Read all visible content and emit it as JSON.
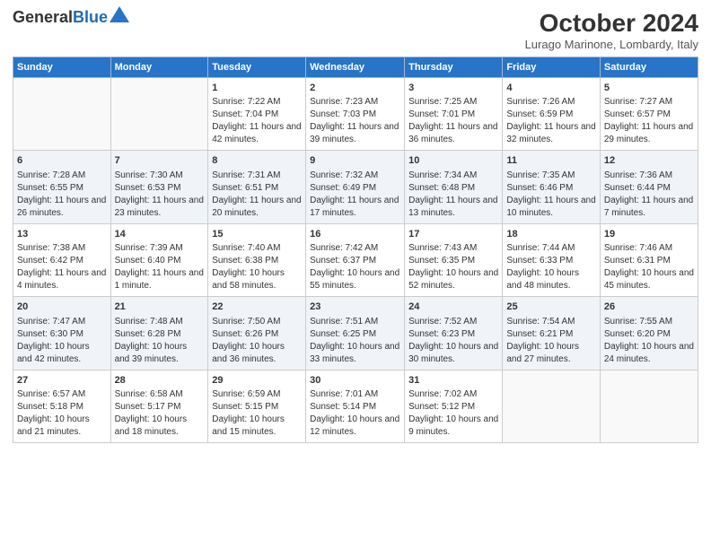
{
  "header": {
    "logo_general": "General",
    "logo_blue": "Blue",
    "month": "October 2024",
    "location": "Lurago Marinone, Lombardy, Italy"
  },
  "days_of_week": [
    "Sunday",
    "Monday",
    "Tuesday",
    "Wednesday",
    "Thursday",
    "Friday",
    "Saturday"
  ],
  "weeks": [
    [
      {
        "day": "",
        "data": ""
      },
      {
        "day": "",
        "data": ""
      },
      {
        "day": "1",
        "data": "Sunrise: 7:22 AM\nSunset: 7:04 PM\nDaylight: 11 hours and 42 minutes."
      },
      {
        "day": "2",
        "data": "Sunrise: 7:23 AM\nSunset: 7:03 PM\nDaylight: 11 hours and 39 minutes."
      },
      {
        "day": "3",
        "data": "Sunrise: 7:25 AM\nSunset: 7:01 PM\nDaylight: 11 hours and 36 minutes."
      },
      {
        "day": "4",
        "data": "Sunrise: 7:26 AM\nSunset: 6:59 PM\nDaylight: 11 hours and 32 minutes."
      },
      {
        "day": "5",
        "data": "Sunrise: 7:27 AM\nSunset: 6:57 PM\nDaylight: 11 hours and 29 minutes."
      }
    ],
    [
      {
        "day": "6",
        "data": "Sunrise: 7:28 AM\nSunset: 6:55 PM\nDaylight: 11 hours and 26 minutes."
      },
      {
        "day": "7",
        "data": "Sunrise: 7:30 AM\nSunset: 6:53 PM\nDaylight: 11 hours and 23 minutes."
      },
      {
        "day": "8",
        "data": "Sunrise: 7:31 AM\nSunset: 6:51 PM\nDaylight: 11 hours and 20 minutes."
      },
      {
        "day": "9",
        "data": "Sunrise: 7:32 AM\nSunset: 6:49 PM\nDaylight: 11 hours and 17 minutes."
      },
      {
        "day": "10",
        "data": "Sunrise: 7:34 AM\nSunset: 6:48 PM\nDaylight: 11 hours and 13 minutes."
      },
      {
        "day": "11",
        "data": "Sunrise: 7:35 AM\nSunset: 6:46 PM\nDaylight: 11 hours and 10 minutes."
      },
      {
        "day": "12",
        "data": "Sunrise: 7:36 AM\nSunset: 6:44 PM\nDaylight: 11 hours and 7 minutes."
      }
    ],
    [
      {
        "day": "13",
        "data": "Sunrise: 7:38 AM\nSunset: 6:42 PM\nDaylight: 11 hours and 4 minutes."
      },
      {
        "day": "14",
        "data": "Sunrise: 7:39 AM\nSunset: 6:40 PM\nDaylight: 11 hours and 1 minute."
      },
      {
        "day": "15",
        "data": "Sunrise: 7:40 AM\nSunset: 6:38 PM\nDaylight: 10 hours and 58 minutes."
      },
      {
        "day": "16",
        "data": "Sunrise: 7:42 AM\nSunset: 6:37 PM\nDaylight: 10 hours and 55 minutes."
      },
      {
        "day": "17",
        "data": "Sunrise: 7:43 AM\nSunset: 6:35 PM\nDaylight: 10 hours and 52 minutes."
      },
      {
        "day": "18",
        "data": "Sunrise: 7:44 AM\nSunset: 6:33 PM\nDaylight: 10 hours and 48 minutes."
      },
      {
        "day": "19",
        "data": "Sunrise: 7:46 AM\nSunset: 6:31 PM\nDaylight: 10 hours and 45 minutes."
      }
    ],
    [
      {
        "day": "20",
        "data": "Sunrise: 7:47 AM\nSunset: 6:30 PM\nDaylight: 10 hours and 42 minutes."
      },
      {
        "day": "21",
        "data": "Sunrise: 7:48 AM\nSunset: 6:28 PM\nDaylight: 10 hours and 39 minutes."
      },
      {
        "day": "22",
        "data": "Sunrise: 7:50 AM\nSunset: 6:26 PM\nDaylight: 10 hours and 36 minutes."
      },
      {
        "day": "23",
        "data": "Sunrise: 7:51 AM\nSunset: 6:25 PM\nDaylight: 10 hours and 33 minutes."
      },
      {
        "day": "24",
        "data": "Sunrise: 7:52 AM\nSunset: 6:23 PM\nDaylight: 10 hours and 30 minutes."
      },
      {
        "day": "25",
        "data": "Sunrise: 7:54 AM\nSunset: 6:21 PM\nDaylight: 10 hours and 27 minutes."
      },
      {
        "day": "26",
        "data": "Sunrise: 7:55 AM\nSunset: 6:20 PM\nDaylight: 10 hours and 24 minutes."
      }
    ],
    [
      {
        "day": "27",
        "data": "Sunrise: 6:57 AM\nSunset: 5:18 PM\nDaylight: 10 hours and 21 minutes."
      },
      {
        "day": "28",
        "data": "Sunrise: 6:58 AM\nSunset: 5:17 PM\nDaylight: 10 hours and 18 minutes."
      },
      {
        "day": "29",
        "data": "Sunrise: 6:59 AM\nSunset: 5:15 PM\nDaylight: 10 hours and 15 minutes."
      },
      {
        "day": "30",
        "data": "Sunrise: 7:01 AM\nSunset: 5:14 PM\nDaylight: 10 hours and 12 minutes."
      },
      {
        "day": "31",
        "data": "Sunrise: 7:02 AM\nSunset: 5:12 PM\nDaylight: 10 hours and 9 minutes."
      },
      {
        "day": "",
        "data": ""
      },
      {
        "day": "",
        "data": ""
      }
    ]
  ]
}
